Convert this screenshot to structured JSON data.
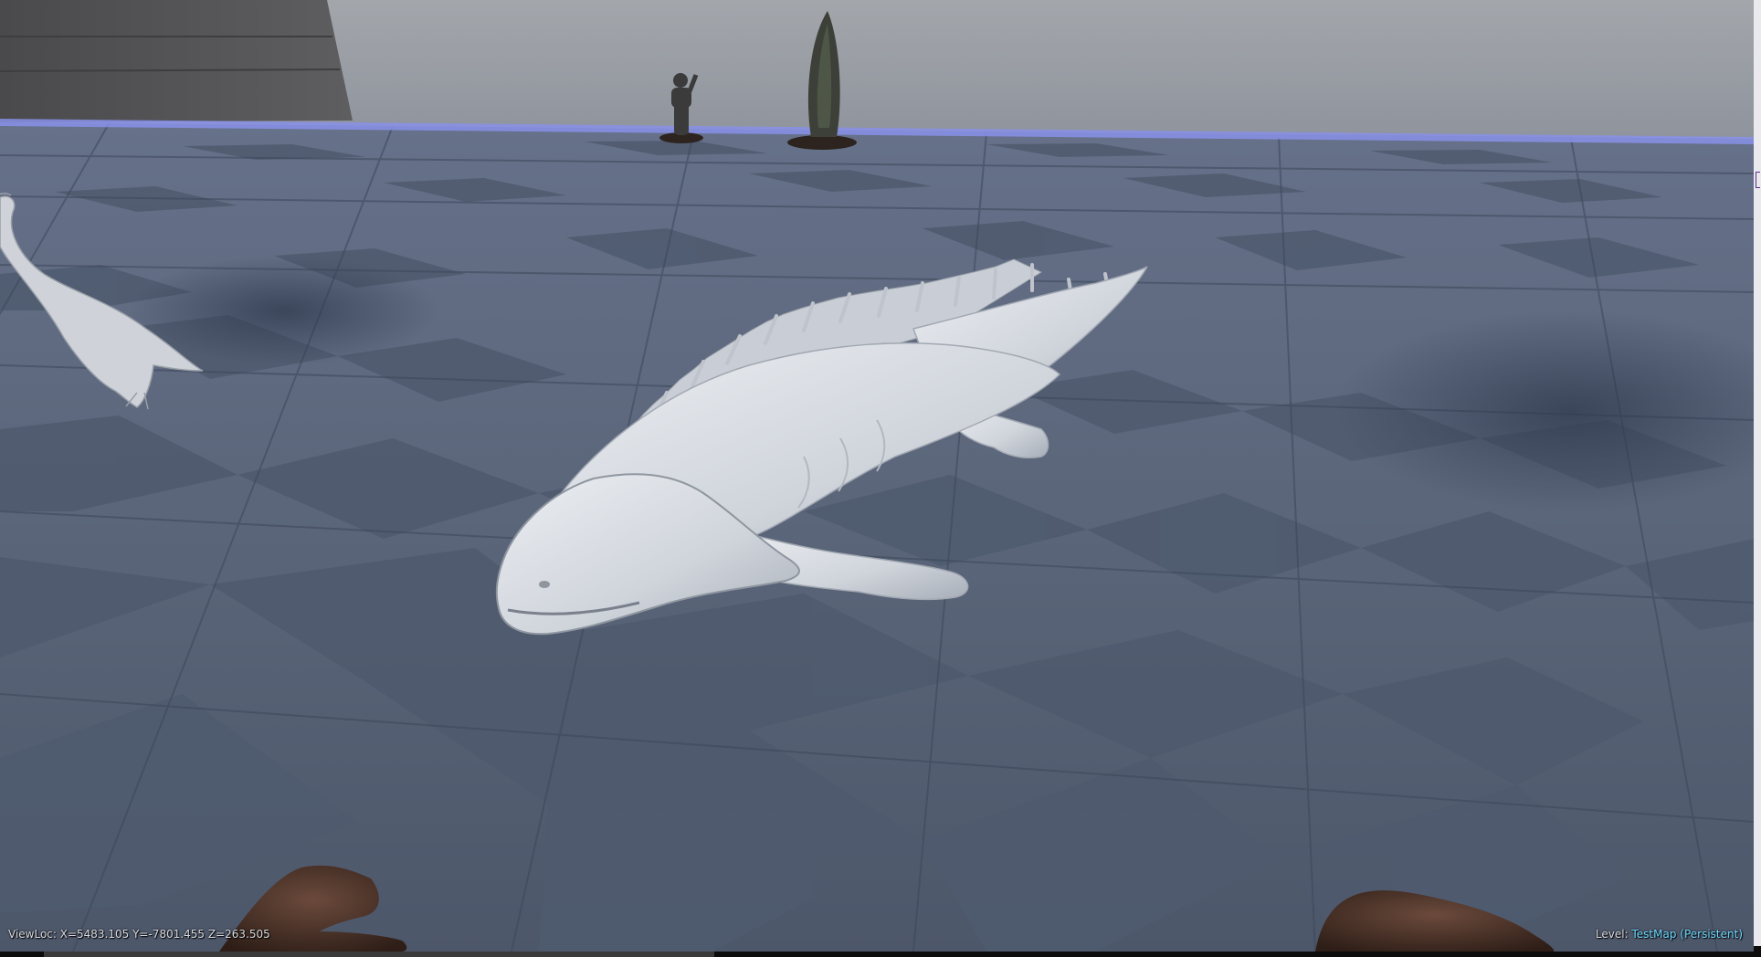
{
  "hud": {
    "viewloc": "ViewLoc: X=5483.105 Y=-7801.455 Z=263.505",
    "level_label": "Level:",
    "level_name": "TestMap (Persistent)"
  },
  "colors": {
    "sky": "#9a9ea6",
    "floor_dark": "#4e5a6d",
    "floor_light": "#6e7a8e",
    "horizon_glow": "#8890e8",
    "creature": "#d9dde3",
    "level_name": "#6fd9ff"
  },
  "icons": {
    "player_hands": "first-person-hands-icon"
  }
}
